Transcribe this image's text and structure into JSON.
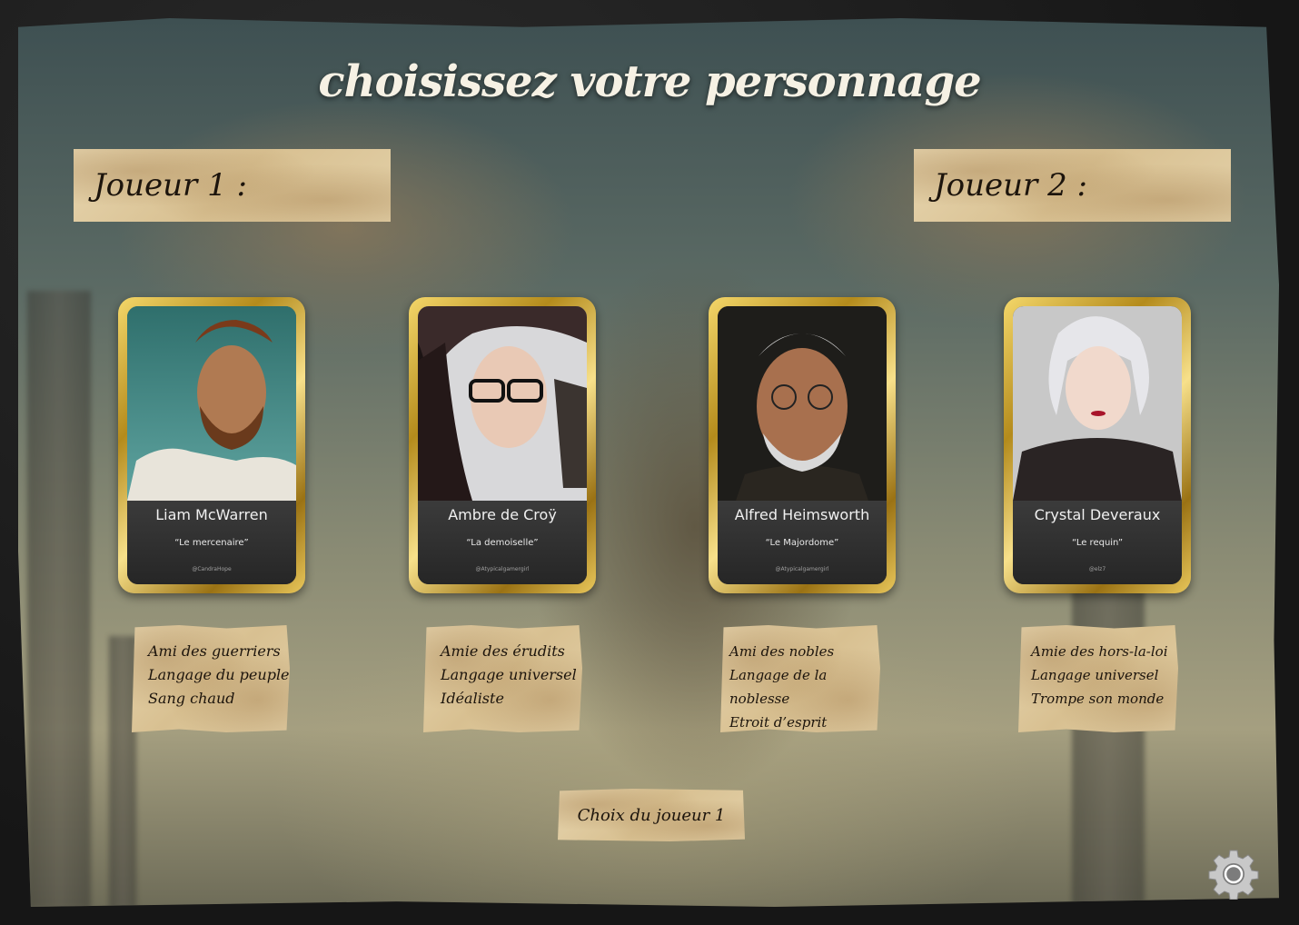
{
  "title": "choisissez votre personnage",
  "players": {
    "p1_label": "Joueur 1 :",
    "p2_label": "Joueur 2 :"
  },
  "characters": [
    {
      "name": "Liam McWarren",
      "nickname": "“Le mercenaire”",
      "credit": "@CandraHope",
      "traits": [
        "Ami des guerriers",
        "Langage du peuple",
        "Sang chaud"
      ]
    },
    {
      "name": "Ambre de Croÿ",
      "nickname": "“La demoiselle”",
      "credit": "@Atypicalgamergirl",
      "traits": [
        "Amie des érudits",
        "Langage universel",
        "Idéaliste"
      ]
    },
    {
      "name": "Alfred Heimsworth",
      "nickname": "“Le Majordome”",
      "credit": "@Atypicalgamergirl",
      "traits": [
        "Ami des nobles",
        "Langage de la noblesse",
        "Etroit d’esprit"
      ]
    },
    {
      "name": "Crystal Deveraux",
      "nickname": "“Le requin”",
      "credit": "@elz7",
      "traits": [
        "Amie des hors-la-loi",
        "Langage universel",
        "Trompe son monde"
      ]
    }
  ],
  "choice_button": "Choix du joueur 1",
  "settings_icon": "gear-icon",
  "colors": {
    "gold": "#d4af37",
    "parchment": "#ddc79b",
    "title": "#f6f1e4"
  }
}
